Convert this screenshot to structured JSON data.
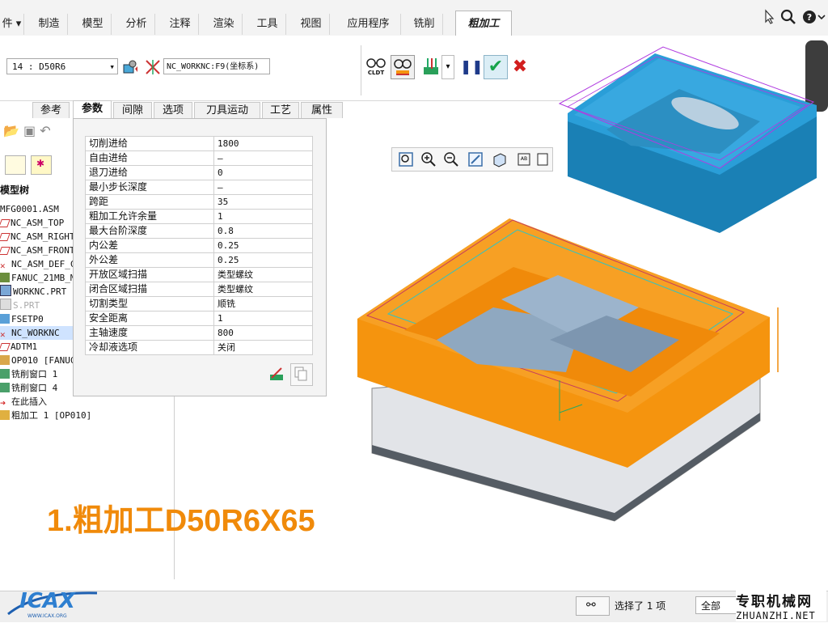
{
  "ribbon": {
    "left_cut_label": "件",
    "tabs": [
      "制造",
      "模型",
      "分析",
      "注释",
      "渲染",
      "工具",
      "视图",
      "应用程序",
      "铣削"
    ],
    "active_tab": "粗加工"
  },
  "toolbar": {
    "tool_select": "14 : D50R6",
    "coord_select": "NC_WORKNC:F9(坐标系)",
    "cldt_label": "CLDT"
  },
  "dashboard_tabs": [
    "参考",
    "参数",
    "间隙",
    "选项",
    "刀具运动",
    "工艺",
    "属性"
  ],
  "dashboard_active": "参数",
  "tree": {
    "title": "模型树",
    "items": [
      "MFG0001.ASM",
      "NC_ASM_TOP",
      "NC_ASM_RIGHT",
      "NC_ASM_FRONT",
      "NC_ASM_DEF_C",
      "FANUC_21MB_M",
      "WORKNC.PRT",
      "S.PRT",
      "FSETP0",
      "NC_WORKNC",
      "ADTM1",
      "OP010 [FANUC",
      "铣削窗口 1",
      "铣削窗口 4",
      "在此插入",
      "粗加工 1 [OP010]"
    ]
  },
  "params": [
    {
      "name": "切削进给",
      "value": "1800"
    },
    {
      "name": "自由进给",
      "value": "–"
    },
    {
      "name": "退刀进给",
      "value": "0"
    },
    {
      "name": "最小步长深度",
      "value": "–"
    },
    {
      "name": "跨距",
      "value": "35"
    },
    {
      "name": "粗加工允许余量",
      "value": "1"
    },
    {
      "name": "最大台阶深度",
      "value": "0.8"
    },
    {
      "name": "内公差",
      "value": "0.25"
    },
    {
      "name": "外公差",
      "value": "0.25"
    },
    {
      "name": "开放区域扫描",
      "value": "类型螺纹"
    },
    {
      "name": "闭合区域扫描",
      "value": "类型螺纹"
    },
    {
      "name": "切割类型",
      "value": "顺铣"
    },
    {
      "name": "安全距离",
      "value": "1"
    },
    {
      "name": "主轴速度",
      "value": "800"
    },
    {
      "name": "冷却液选项",
      "value": "关闭"
    }
  ],
  "caption": "1.粗加工D50R6X65",
  "status": {
    "selection": "选择了 1 项",
    "filter": "全部"
  },
  "watermark": {
    "logo": "ICAX",
    "logo_url": "WWW.ICAX.ORG",
    "site_cn": "专职机械网",
    "site_en": "ZHUANZHI.NET"
  },
  "colors": {
    "orange": "#f5940e",
    "blue": "#2a9ed8",
    "accept": "#16a34a",
    "cancel": "#d21e1e",
    "pause": "#1e3a8a"
  }
}
